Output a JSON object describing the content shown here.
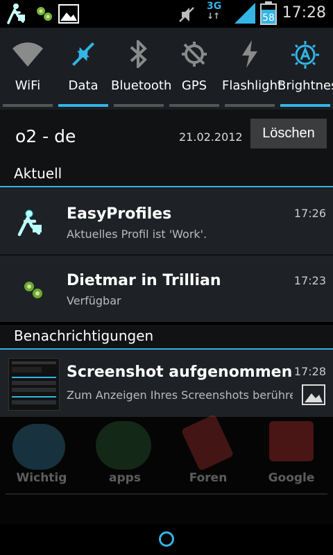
{
  "status_bar": {
    "time": "17:28",
    "network_type": "3G",
    "battery_level": "58",
    "icons": [
      "easyprofiles-walker-icon",
      "trillian-icon",
      "image-icon",
      "mute-icon",
      "signal-icon",
      "battery-icon"
    ]
  },
  "quick_settings": {
    "items": [
      {
        "label": "WiFi",
        "icon": "wifi-icon",
        "active": false
      },
      {
        "label": "Data",
        "icon": "data-icon",
        "active": true
      },
      {
        "label": "Bluetooth",
        "icon": "bluetooth-icon",
        "active": false
      },
      {
        "label": "GPS",
        "icon": "gps-icon",
        "active": false
      },
      {
        "label": "Flashlight",
        "icon": "flashlight-icon",
        "active": false
      },
      {
        "label": "Brightness",
        "icon": "brightness-auto-icon",
        "active": true
      }
    ]
  },
  "carrier_row": {
    "carrier": "o2 - de",
    "date": "21.02.2012",
    "clear_label": "Löschen"
  },
  "sections": {
    "current": "Aktuell",
    "notifications": "Benachrichtigungen"
  },
  "ongoing": [
    {
      "title": "EasyProfiles",
      "text": "Aktuelles Profil ist 'Work'.",
      "time": "17:26",
      "icon": "easyprofiles-walker-icon"
    },
    {
      "title": "Dietmar in Trillian",
      "text": "Verfügbar",
      "time": "17:23",
      "icon": "trillian-icon"
    }
  ],
  "notifications": [
    {
      "title": "Screenshot aufgenommen",
      "text": "Zum Anzeigen Ihres Screenshots berühren",
      "time": "17:28",
      "icon": "screenshot-thumbnail",
      "small_icon": "image-icon"
    }
  ],
  "launcher_background": {
    "apps": [
      "Wichtig",
      "apps",
      "Foren",
      "Google"
    ]
  },
  "colors": {
    "accent": "#33b5e5",
    "panel": "#1e2125",
    "header_bg": "#101214"
  }
}
